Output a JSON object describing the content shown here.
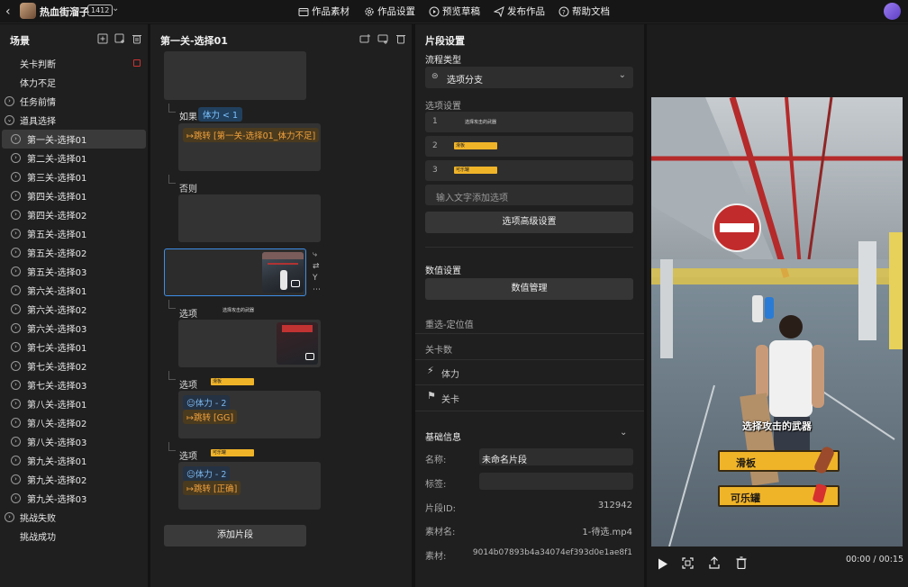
{
  "header": {
    "project_title": "热血街溜子",
    "badge": "1412",
    "menu": [
      "作品素材",
      "作品设置",
      "预览草稿",
      "发布作品",
      "帮助文档"
    ]
  },
  "scene_panel": {
    "title": "场景",
    "items": [
      {
        "label": "关卡判断",
        "type": "plain"
      },
      {
        "label": "体力不足",
        "type": "plain"
      },
      {
        "label": "任务前情",
        "type": "group"
      },
      {
        "label": "道具选择",
        "type": "group-open"
      },
      {
        "label": "第一关-选择01",
        "type": "child",
        "selected": true
      },
      {
        "label": "第二关-选择01",
        "type": "child"
      },
      {
        "label": "第三关-选择01",
        "type": "child"
      },
      {
        "label": "第四关-选择01",
        "type": "child"
      },
      {
        "label": "第四关-选择02",
        "type": "child"
      },
      {
        "label": "第五关-选择01",
        "type": "child"
      },
      {
        "label": "第五关-选择02",
        "type": "child"
      },
      {
        "label": "第五关-选择03",
        "type": "child"
      },
      {
        "label": "第六关-选择01",
        "type": "child"
      },
      {
        "label": "第六关-选择02",
        "type": "child"
      },
      {
        "label": "第六关-选择03",
        "type": "child"
      },
      {
        "label": "第七关-选择01",
        "type": "child"
      },
      {
        "label": "第七关-选择02",
        "type": "child"
      },
      {
        "label": "第七关-选择03",
        "type": "child"
      },
      {
        "label": "第八关-选择01",
        "type": "child"
      },
      {
        "label": "第八关-选择02",
        "type": "child"
      },
      {
        "label": "第八关-选择03",
        "type": "child"
      },
      {
        "label": "第九关-选择01",
        "type": "child"
      },
      {
        "label": "第九关-选择02",
        "type": "child"
      },
      {
        "label": "第九关-选择03",
        "type": "child"
      },
      {
        "label": "挑战失败",
        "type": "group"
      },
      {
        "label": "挑战成功",
        "type": "plain"
      }
    ]
  },
  "flow_panel": {
    "title": "第一关-选择01",
    "if_label": "如果",
    "if_condition": "体力 < 1",
    "if_action": "↦跳转 [第一关-选择01_体力不足]",
    "else_label": "否则",
    "option_label": "选项",
    "opt1_caption": "选择攻击的武器",
    "opt2_stat": "☺体力 - 2",
    "opt2_action": "↦跳转 [GG]",
    "opt3_stat": "☺体力 - 2",
    "opt3_action": "↦跳转 [正确]",
    "add_button": "添加片段"
  },
  "segment_panel": {
    "title": "片段设置",
    "flow_type_label": "流程类型",
    "flow_type_value": "选项分支",
    "options_label": "选项设置",
    "options": [
      {
        "index": "1",
        "text": "选择攻击的武器"
      },
      {
        "index": "2",
        "text": "滑板"
      },
      {
        "index": "3",
        "text": "可乐罐"
      }
    ],
    "option_placeholder": "输入文字添加选项",
    "advanced_button": "选项高级设置",
    "value_settings_label": "数值设置",
    "value_manage_button": "数值管理",
    "reset_label": "重选-定位值",
    "level_count_label": "关卡数",
    "stat_stamina": "体力",
    "stat_level": "关卡",
    "basic_info_label": "基础信息",
    "name_label": "名称:",
    "name_value": "未命名片段",
    "tag_label": "标签:",
    "id_label": "片段ID:",
    "id_value": "312942",
    "material_name_label": "素材名:",
    "material_name_value": "1-待选.mp4",
    "material_label": "素材:",
    "material_value": "9014b07893b4a34074ef393d0e1ae8f1"
  },
  "preview": {
    "overlay_title": "选择攻击的武器",
    "choice_1": "滑板",
    "choice_2": "可乐罐",
    "time": "00:00 / 00:15"
  },
  "colors": {
    "accent_blue": "#2f86e6",
    "tag_orange": "#f2a23b",
    "choice_yellow": "#f0b429"
  }
}
